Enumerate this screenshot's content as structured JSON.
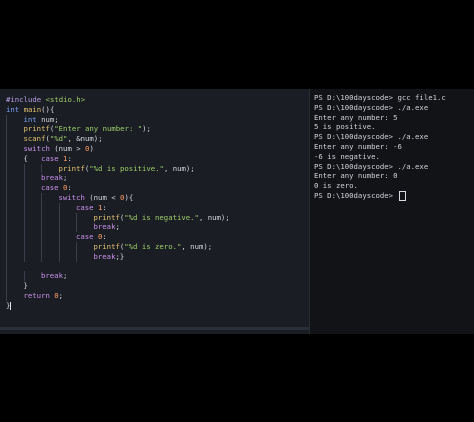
{
  "editor": {
    "lines": [
      {
        "indent": 0,
        "tokens": [
          [
            "pp",
            "#include "
          ],
          [
            "str",
            "<stdio.h>"
          ]
        ]
      },
      {
        "indent": 0,
        "tokens": [
          [
            "ty",
            "int "
          ],
          [
            "fn",
            "main"
          ],
          [
            "plain",
            "(){"
          ]
        ]
      },
      {
        "indent": 1,
        "tokens": [
          [
            "ty",
            "int "
          ],
          [
            "plain",
            "num;"
          ]
        ]
      },
      {
        "indent": 1,
        "tokens": [
          [
            "fn",
            "printf"
          ],
          [
            "plain",
            "("
          ],
          [
            "str",
            "\"Enter any number: \""
          ],
          [
            "plain",
            ");"
          ]
        ]
      },
      {
        "indent": 1,
        "tokens": [
          [
            "fn",
            "scanf"
          ],
          [
            "plain",
            "("
          ],
          [
            "str",
            "\"%d\""
          ],
          [
            "plain",
            ", &num);"
          ]
        ]
      },
      {
        "indent": 1,
        "tokens": [
          [
            "ctrl",
            "switch "
          ],
          [
            "plain",
            "(num > "
          ],
          [
            "num",
            "0"
          ],
          [
            "plain",
            ")"
          ]
        ]
      },
      {
        "indent": 1,
        "tokens": [
          [
            "plain",
            "{   "
          ],
          [
            "ctrl",
            "case "
          ],
          [
            "num",
            "1"
          ],
          [
            "plain",
            ":"
          ]
        ]
      },
      {
        "indent": 3,
        "tokens": [
          [
            "fn",
            "printf"
          ],
          [
            "plain",
            "("
          ],
          [
            "str",
            "\"%d is positive.\""
          ],
          [
            "plain",
            ", num);"
          ]
        ]
      },
      {
        "indent": 2,
        "tokens": [
          [
            "ctrl",
            "break"
          ],
          [
            "plain",
            ";"
          ]
        ]
      },
      {
        "indent": 2,
        "tokens": [
          [
            "ctrl",
            "case "
          ],
          [
            "num",
            "0"
          ],
          [
            "plain",
            ":"
          ]
        ]
      },
      {
        "indent": 3,
        "tokens": [
          [
            "ctrl",
            "switch "
          ],
          [
            "plain",
            "(num < "
          ],
          [
            "num",
            "0"
          ],
          [
            "plain",
            "){"
          ]
        ]
      },
      {
        "indent": 4,
        "tokens": [
          [
            "ctrl",
            "case "
          ],
          [
            "num",
            "1"
          ],
          [
            "plain",
            ":"
          ]
        ]
      },
      {
        "indent": 5,
        "tokens": [
          [
            "fn",
            "printf"
          ],
          [
            "plain",
            "("
          ],
          [
            "str",
            "\"%d is negative.\""
          ],
          [
            "plain",
            ", num);"
          ]
        ]
      },
      {
        "indent": 5,
        "tokens": [
          [
            "ctrl",
            "break"
          ],
          [
            "plain",
            ";"
          ]
        ]
      },
      {
        "indent": 4,
        "tokens": [
          [
            "ctrl",
            "case "
          ],
          [
            "num",
            "0"
          ],
          [
            "plain",
            ":"
          ]
        ]
      },
      {
        "indent": 5,
        "tokens": [
          [
            "fn",
            "printf"
          ],
          [
            "plain",
            "("
          ],
          [
            "str",
            "\"%d is zero.\""
          ],
          [
            "plain",
            ", num);"
          ]
        ]
      },
      {
        "indent": 5,
        "tokens": [
          [
            "ctrl",
            "break"
          ],
          [
            "plain",
            ";}"
          ]
        ]
      },
      {
        "indent": 1,
        "tokens": [
          [
            "plain",
            ""
          ]
        ]
      },
      {
        "indent": 2,
        "tokens": [
          [
            "ctrl",
            "break"
          ],
          [
            "plain",
            ";"
          ]
        ]
      },
      {
        "indent": 1,
        "tokens": [
          [
            "plain",
            "}"
          ]
        ]
      },
      {
        "indent": 1,
        "tokens": [
          [
            "ctrl",
            "return "
          ],
          [
            "num",
            "0"
          ],
          [
            "plain",
            ";"
          ]
        ]
      },
      {
        "indent": 0,
        "tokens": [
          [
            "plain",
            "}"
          ]
        ]
      }
    ]
  },
  "terminal": {
    "lines": [
      "PS D:\\100dayscode> gcc file1.c",
      "PS D:\\100dayscode> ./a.exe",
      "Enter any number: 5",
      "5 is positive.",
      "PS D:\\100dayscode> ./a.exe",
      "Enter any number: -6",
      "-6 is negative.",
      "PS D:\\100dayscode> ./a.exe",
      "Enter any number: 0",
      "0 is zero.",
      "PS D:\\100dayscode> "
    ]
  }
}
